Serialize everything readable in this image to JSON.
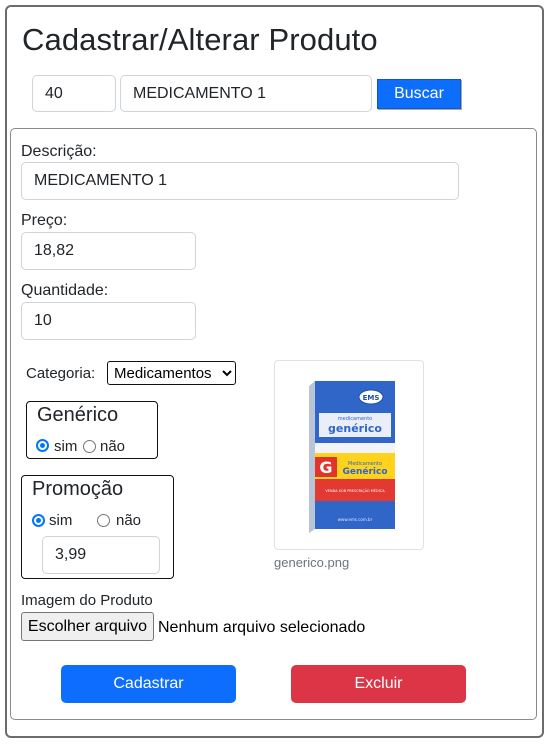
{
  "page": {
    "title": "Cadastrar/Alterar Produto"
  },
  "search": {
    "code_value": "40",
    "name_value": "MEDICAMENTO 1",
    "button_label": "Buscar"
  },
  "form": {
    "descricao_label": "Descrição:",
    "descricao_value": "MEDICAMENTO 1",
    "preco_label": "Preço:",
    "preco_value": "18,82",
    "quantidade_label": "Quantidade:",
    "quantidade_value": "10",
    "categoria_label": "Categoria:",
    "categoria_selected": "Medicamentos",
    "generico": {
      "legend": "Genérico",
      "options": [
        "sim",
        "não"
      ],
      "selected": "sim"
    },
    "promocao": {
      "legend": "Promoção",
      "options": [
        "sim",
        "não"
      ],
      "selected": "sim",
      "price_value": "3,99"
    },
    "image": {
      "caption": "generico.png",
      "package_texts": [
        "EMS",
        "medicamento",
        "genérico",
        "G",
        "Medicamento",
        "Genérico",
        "VENDA SOB PRESCRIÇÃO MÉDICA",
        "www.ems.com.br"
      ]
    },
    "imagem_label": "Imagem do Produto",
    "file_button_label": "Escolher arquivo",
    "file_status": "Nenhum arquivo selecionado"
  },
  "actions": {
    "cadastrar_label": "Cadastrar",
    "excluir_label": "Excluir"
  },
  "colors": {
    "primary": "#0d6efd",
    "danger": "#dc3545"
  }
}
